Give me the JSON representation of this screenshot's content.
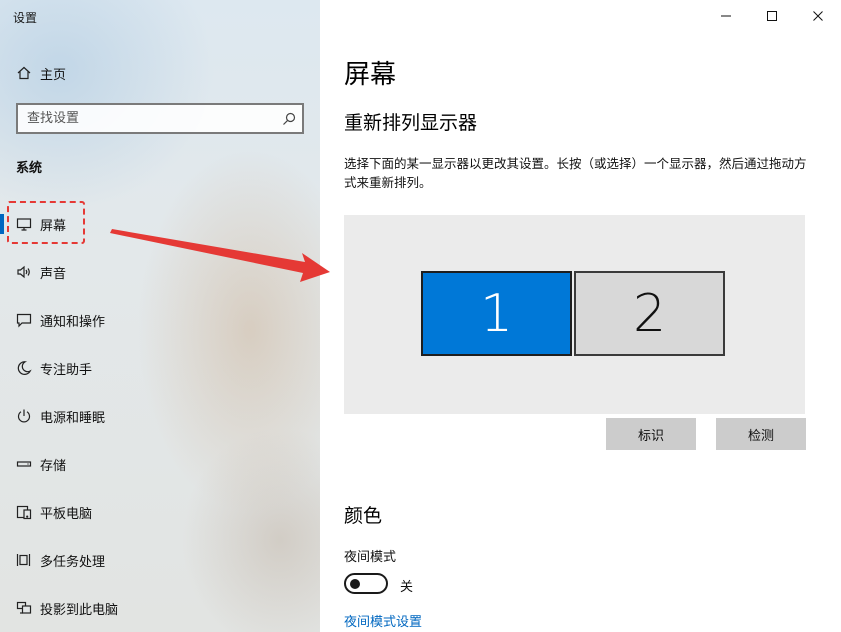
{
  "window": {
    "title": "设置"
  },
  "sidebar": {
    "home_label": "主页",
    "search_placeholder": "查找设置",
    "section_label": "系统",
    "items": [
      {
        "label": "屏幕",
        "icon": "monitor-icon",
        "active": true
      },
      {
        "label": "声音",
        "icon": "speaker-icon"
      },
      {
        "label": "通知和操作",
        "icon": "message-icon"
      },
      {
        "label": "专注助手",
        "icon": "moon-icon"
      },
      {
        "label": "电源和睡眠",
        "icon": "power-icon"
      },
      {
        "label": "存储",
        "icon": "storage-icon"
      },
      {
        "label": "平板电脑",
        "icon": "tablet-icon"
      },
      {
        "label": "多任务处理",
        "icon": "multitask-icon"
      },
      {
        "label": "投影到此电脑",
        "icon": "project-icon"
      }
    ]
  },
  "main": {
    "title": "屏幕",
    "rearrange_title": "重新排列显示器",
    "rearrange_desc": "选择下面的某一显示器以更改其设置。长按（或选择）一个显示器，然后通过拖动方式来重新排列。",
    "monitors": [
      {
        "label": "1",
        "selected": true
      },
      {
        "label": "2",
        "selected": false
      }
    ],
    "identify_label": "标识",
    "detect_label": "检测",
    "color_title": "颜色",
    "night_light_label": "夜间模式",
    "night_light_state": "关",
    "night_light_link": "夜间模式设置"
  },
  "colors": {
    "accent": "#0078d7",
    "link": "#0067c0",
    "annotation": "#e53935"
  }
}
